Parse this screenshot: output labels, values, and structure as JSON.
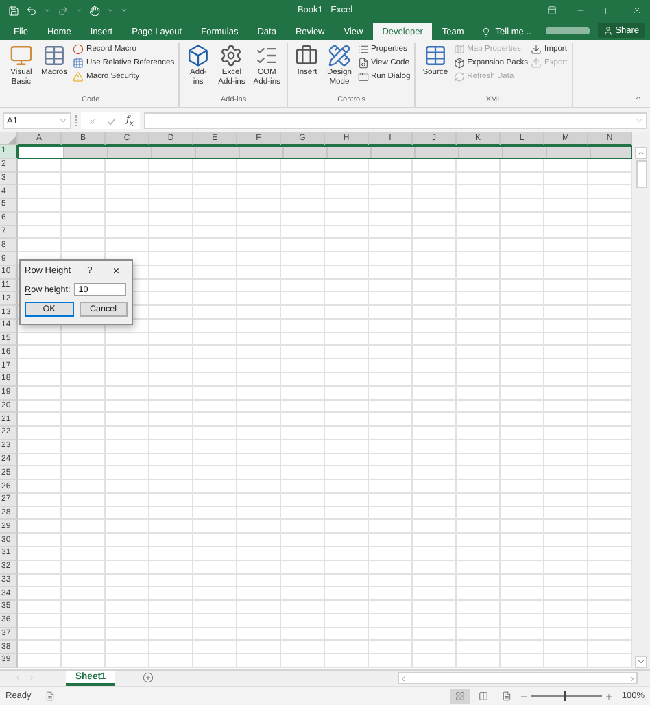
{
  "window": {
    "title": "Book1 - Excel"
  },
  "ribbon_tabs": [
    {
      "label": "File",
      "selected": false
    },
    {
      "label": "Home",
      "selected": false
    },
    {
      "label": "Insert",
      "selected": false
    },
    {
      "label": "Page Layout",
      "selected": false
    },
    {
      "label": "Formulas",
      "selected": false
    },
    {
      "label": "Data",
      "selected": false
    },
    {
      "label": "Review",
      "selected": false
    },
    {
      "label": "View",
      "selected": false
    },
    {
      "label": "Developer",
      "selected": true
    },
    {
      "label": "Team",
      "selected": false
    }
  ],
  "tell_me": {
    "label": "Tell me..."
  },
  "share": {
    "label": "Share"
  },
  "ribbon_groups": [
    {
      "label": "Code",
      "items": [
        {
          "kind": "large",
          "label": "Visual\nBasic"
        },
        {
          "kind": "large",
          "label": "Macros"
        },
        {
          "kind": "stack",
          "items": [
            {
              "label": "Record Macro",
              "disabled": false
            },
            {
              "label": "Use Relative References",
              "disabled": false
            },
            {
              "label": "Macro Security",
              "disabled": false
            }
          ]
        }
      ]
    },
    {
      "label": "Add-ins",
      "items": [
        {
          "kind": "large",
          "label": "Add-\nins"
        },
        {
          "kind": "large",
          "label": "Excel\nAdd-ins"
        },
        {
          "kind": "large",
          "label": "COM\nAdd-ins"
        }
      ]
    },
    {
      "label": "Controls",
      "items": [
        {
          "kind": "large",
          "label": "Insert"
        },
        {
          "kind": "large",
          "label": "Design\nMode"
        },
        {
          "kind": "stack",
          "items": [
            {
              "label": "Properties",
              "disabled": false
            },
            {
              "label": "View Code",
              "disabled": false
            },
            {
              "label": "Run Dialog",
              "disabled": false
            }
          ]
        }
      ]
    },
    {
      "label": "XML",
      "items": [
        {
          "kind": "large",
          "label": "Source"
        },
        {
          "kind": "stack",
          "items": [
            {
              "label": "Map Properties",
              "disabled": true
            },
            {
              "label": "Expansion Packs",
              "disabled": false
            },
            {
              "label": "Refresh Data",
              "disabled": true
            }
          ]
        },
        {
          "kind": "stack",
          "items": [
            {
              "label": "Import",
              "disabled": false
            },
            {
              "label": "Export",
              "disabled": true
            }
          ]
        }
      ]
    }
  ],
  "name_box": {
    "value": "A1"
  },
  "formula_bar": {
    "function_label": "f$_{x}$"
  },
  "sheet": {
    "columns": [
      "A",
      "B",
      "C",
      "D",
      "E",
      "F",
      "G",
      "H",
      "I",
      "J",
      "K",
      "L",
      "M",
      "N"
    ],
    "rows": [
      {
        "label": "1",
        "selected": true
      },
      {
        "label": "2",
        "selected": false
      },
      {
        "label": "3",
        "selected": false
      },
      {
        "label": "4",
        "selected": false
      },
      {
        "label": "5",
        "selected": false
      },
      {
        "label": "6",
        "selected": false
      },
      {
        "label": "7",
        "selected": false
      },
      {
        "label": "8",
        "selected": false
      },
      {
        "label": "9",
        "selected": false
      },
      {
        "label": "10",
        "selected": false
      },
      {
        "label": "11",
        "selected": false
      },
      {
        "label": "12",
        "selected": false
      },
      {
        "label": "13",
        "selected": false
      },
      {
        "label": "14",
        "selected": false
      },
      {
        "label": "15",
        "selected": false
      },
      {
        "label": "16",
        "selected": false
      },
      {
        "label": "17",
        "selected": false
      },
      {
        "label": "18",
        "selected": false
      },
      {
        "label": "19",
        "selected": false
      },
      {
        "label": "20",
        "selected": false
      },
      {
        "label": "21",
        "selected": false
      },
      {
        "label": "22",
        "selected": false
      },
      {
        "label": "23",
        "selected": false
      },
      {
        "label": "24",
        "selected": false
      },
      {
        "label": "25",
        "selected": false
      },
      {
        "label": "26",
        "selected": false
      },
      {
        "label": "27",
        "selected": false
      },
      {
        "label": "28",
        "selected": false
      },
      {
        "label": "29",
        "selected": false
      },
      {
        "label": "30",
        "selected": false
      },
      {
        "label": "31",
        "selected": false
      },
      {
        "label": "32",
        "selected": false
      },
      {
        "label": "33",
        "selected": false
      },
      {
        "label": "34",
        "selected": false
      },
      {
        "label": "35",
        "selected": false
      },
      {
        "label": "36",
        "selected": false
      },
      {
        "label": "37",
        "selected": false
      },
      {
        "label": "38",
        "selected": false
      },
      {
        "label": "39",
        "selected": false
      }
    ]
  },
  "sheet_tabs": [
    {
      "label": "Sheet1",
      "selected": true
    }
  ],
  "status_bar": {
    "status": "Ready",
    "views": [
      {
        "selected": true
      },
      {
        "selected": false
      },
      {
        "selected": false
      }
    ],
    "zoom_slider": {
      "level": 0.46
    },
    "zoom": "100%"
  },
  "dialog": {
    "title": "Row Height",
    "help": "?",
    "close": "×",
    "field_label": "Row height:",
    "value": "10",
    "buttons": [
      {
        "label": "OK",
        "default": true
      },
      {
        "label": "Cancel",
        "default": false
      }
    ]
  }
}
